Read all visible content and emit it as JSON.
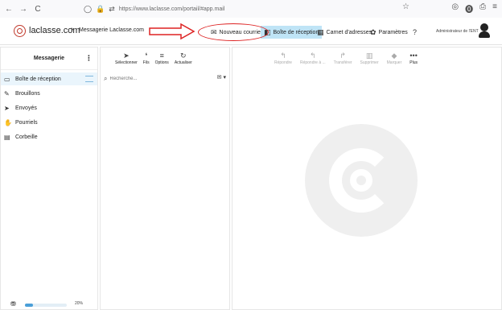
{
  "browser": {
    "back_glyph": "←",
    "forward_glyph": "→",
    "reload_glyph": "C",
    "shield_glyph": "◯",
    "lock_glyph": "🔒",
    "tune_glyph": "⇄",
    "url": "https://www.laclasse.com/portail/#app.mail",
    "star_glyph": "☆",
    "right_icons": [
      "◎",
      "⓿",
      "⎙",
      "≡"
    ]
  },
  "header": {
    "brand": "laclasse.com",
    "breadcrumb_sep": "›",
    "breadcrumb": "Messagerie Laclasse.com",
    "buttons": [
      {
        "label": "Nouveau courriel",
        "icon": "✉",
        "icon_name": "envelope-icon"
      },
      {
        "label": "Boîte de réception",
        "icon": "◧",
        "icon_name": "inbox-icon",
        "active": true
      },
      {
        "label": "Carnet d'adresses",
        "icon": "▦",
        "icon_name": "addressbook-icon"
      },
      {
        "label": "Paramètres",
        "icon": "✿",
        "icon_name": "gear-icon"
      },
      {
        "label": "",
        "icon": "?",
        "icon_name": "help-icon"
      }
    ],
    "user": "Administrateur de l'ENT",
    "annotation_color": "#dd2222"
  },
  "left": {
    "title": "Messagerie",
    "kebab_glyph": "⋮",
    "folders": [
      {
        "label": "Boîte de réception",
        "icon": "▭",
        "icon_name": "inbox-icon",
        "selected": true
      },
      {
        "label": "Brouillons",
        "icon": "✎",
        "icon_name": "pencil-icon"
      },
      {
        "label": "Envoyés",
        "icon": "➤",
        "icon_name": "paper-plane-icon"
      },
      {
        "label": "Pourriels",
        "icon": "✋",
        "icon_name": "hand-icon"
      },
      {
        "label": "Corbeille",
        "icon": "▤",
        "icon_name": "trash-icon"
      }
    ],
    "quota": {
      "text": "20%",
      "value": 0.2,
      "icon": "⛃"
    }
  },
  "mid": {
    "toolbar": [
      {
        "label": "Sélectionner",
        "icon": "➤",
        "icon_name": "pointer-icon"
      },
      {
        "label": "Fils",
        "icon": "❛",
        "icon_name": "threads-icon"
      },
      {
        "label": "Options",
        "icon": "≡",
        "icon_name": "options-icon"
      },
      {
        "label": "Actualiser",
        "icon": "↻",
        "icon_name": "refresh-icon"
      }
    ],
    "search": {
      "placeholder": "Recherche...",
      "icon": "⌕",
      "filter_glyph": "✉ ▾"
    }
  },
  "right": {
    "toolbar": [
      {
        "label": "Répondre",
        "icon": "↰",
        "icon_name": "reply-icon",
        "disabled": true
      },
      {
        "label": "Répondre à ...",
        "icon": "↰",
        "icon_name": "reply-all-icon",
        "disabled": true
      },
      {
        "label": "Transférer",
        "icon": "↱",
        "icon_name": "forward-icon",
        "disabled": true
      },
      {
        "label": "Supprimer",
        "icon": "▥",
        "icon_name": "delete-icon",
        "disabled": true
      },
      {
        "label": "Marquer",
        "icon": "◆",
        "icon_name": "tag-icon",
        "disabled": true
      },
      {
        "label": "Plus",
        "icon": "•••",
        "icon_name": "more-icon",
        "disabled": false
      }
    ]
  }
}
